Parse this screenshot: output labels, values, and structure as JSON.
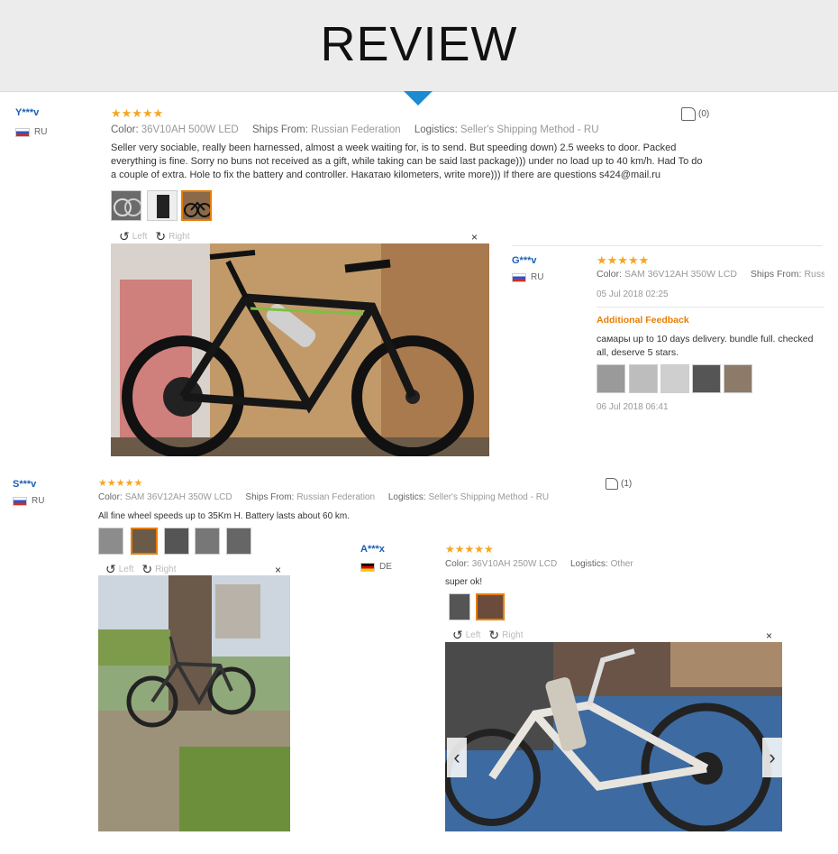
{
  "header": {
    "title": "REVIEW"
  },
  "reviews": [
    {
      "user": "Y***v",
      "country": "RU",
      "stars": "★★★★★",
      "color_label": "Color:",
      "color_value": "36V10AH 500W LED",
      "ships_label": "Ships From:",
      "ships_value": "Russian Federation",
      "logistics_label": "Logistics:",
      "logistics_value": "Seller's Shipping Method - RU",
      "likes": "(0)",
      "text": "Seller very sociable, really been harnessed, almost a week waiting for, is to send. But speeding down) 2.5 weeks to door. Packed everything is fine. Sorry no buns not received as a gift, while taking can be said last package))) under no load up to 40 km/h. Had To do a couple of extra. Hole to fix the battery and controller. Накатаю kilometers, write more))) If there are questions s424@mail.ru",
      "viewer": {
        "left": "Left",
        "right": "Right",
        "close": "×"
      }
    },
    {
      "user": "G***v",
      "country": "RU",
      "stars": "★★★★★",
      "color_label": "Color:",
      "color_value": "SAM 36V12AH 350W LCD",
      "ships_label": "Ships From:",
      "ships_value": "Russian F",
      "date1": "05 Jul 2018 02:25",
      "additional_title": "Additional Feedback",
      "additional_text": "самары up to 10 days delivery. bundle full. checked all, deserve 5 stars.",
      "date2": "06 Jul 2018 06:41"
    },
    {
      "user": "S***v",
      "country": "RU",
      "stars": "★★★★★",
      "color_label": "Color:",
      "color_value": "SAM 36V12AH 350W LCD",
      "ships_label": "Ships From:",
      "ships_value": "Russian Federation",
      "logistics_label": "Logistics:",
      "logistics_value": "Seller's Shipping Method - RU",
      "likes": "(1)",
      "text": "All fine wheel speeds up to 35Km H. Battery lasts about 60 km.",
      "viewer": {
        "left": "Left",
        "right": "Right",
        "close": "×"
      }
    },
    {
      "user": "A***x",
      "country": "DE",
      "stars": "★★★★★",
      "color_label": "Color:",
      "color_value": "36V10AH 250W LCD",
      "logistics_label": "Logistics:",
      "logistics_value": "Other",
      "text": "super ok!",
      "viewer": {
        "left": "Left",
        "right": "Right",
        "close": "×"
      },
      "prev": "‹",
      "next": "›"
    }
  ]
}
